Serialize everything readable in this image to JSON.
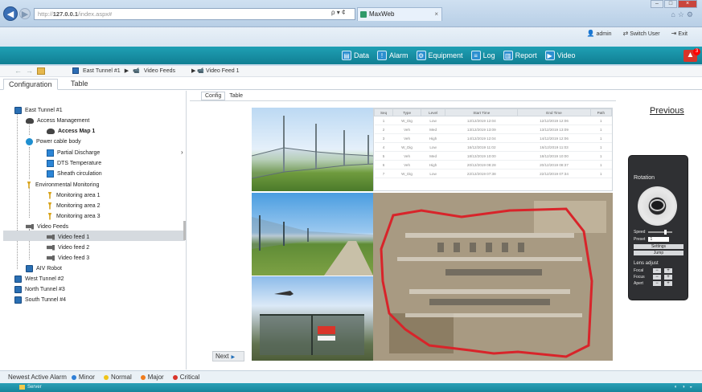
{
  "browser": {
    "url_scheme": "http://",
    "url_host": "127.0.0.1",
    "url_path": "/index.aspx#",
    "address_tools": "ρ ▾ ¢",
    "tab_title": "MaxWeb",
    "tab_close": "×"
  },
  "header": {
    "user": "admin",
    "switch_user": "Switch User",
    "exit": "Exit",
    "alarm_count": "3",
    "menu": [
      {
        "label": "Data",
        "icon": "data-icon",
        "color": "#2b8fd0"
      },
      {
        "label": "Alarm",
        "icon": "alarm-icon",
        "color": "#2b8fd0"
      },
      {
        "label": "Equipment",
        "icon": "equipment-icon",
        "color": "#2b8fd0"
      },
      {
        "label": "Log",
        "icon": "log-icon",
        "color": "#2b8fd0"
      },
      {
        "label": "Report",
        "icon": "report-icon",
        "color": "#2b8fd0"
      },
      {
        "label": "Video",
        "icon": "video-icon",
        "color": "#2b8fd0"
      }
    ]
  },
  "breadcrumb": {
    "item1": "East Tunnel #1",
    "item2": "Video Feeds",
    "item3": "Video Feed 1"
  },
  "tabs": {
    "configuration": "Configuration",
    "table": "Table"
  },
  "tree": {
    "east_tunnel": "East Tunnel #1",
    "access_management": "Access Management",
    "access_map": "Access Map 1",
    "power_cable": "Power cable body",
    "partial_discharge": "Partial Discharge",
    "dts_temperature": "DTS Temperature",
    "sheath_circulation": "Sheath circulation",
    "environmental_monitoring": "Environmental Monitoring",
    "area1": "Monitoring area 1",
    "area2": "Monitoring area 2",
    "area3": "Monitoring area 3",
    "video_feeds": "Video Feeds",
    "feed1": "Video feed 1",
    "feed2": "Video feed 2",
    "feed3": "Video feed 3",
    "aiv_robot": "AIV Robot",
    "west_tunnel": "West Tunnel #2",
    "north_tunnel": "North Tunnel #3",
    "south_tunnel": "South Tunnel #4"
  },
  "subtabs": {
    "config": "Config",
    "table": "Table"
  },
  "grid": {
    "headers": [
      "Seq",
      "Type",
      "Level",
      "Start Time",
      "End Time",
      "Path"
    ],
    "rows": [
      [
        "1",
        "W_Dig",
        "Low",
        "12/12/2019 12:04",
        "12/12/2019 12:06",
        "1"
      ],
      [
        "2",
        "Veh",
        "Med",
        "13/12/2019 13:09",
        "13/12/2019 13:09",
        "1"
      ],
      [
        "3",
        "Veh",
        "High",
        "14/12/2019 12:04",
        "14/12/2019 12:06",
        "1"
      ],
      [
        "4",
        "W_Dig",
        "Low",
        "16/12/2019 11:02",
        "16/12/2019 11:03",
        "1"
      ],
      [
        "5",
        "Veh",
        "Med",
        "18/12/2019 10:00",
        "18/12/2019 10:00",
        "1"
      ],
      [
        "6",
        "Veh",
        "High",
        "20/12/2019 08:28",
        "20/12/2019 08:37",
        "1"
      ],
      [
        "7",
        "W_Dig",
        "Low",
        "22/12/2019 07:38",
        "22/12/2019 07:34",
        "1"
      ]
    ]
  },
  "next_label": "Next",
  "previous_label": "Previous",
  "ptz": {
    "title": "Rotation",
    "speed": "Speed",
    "preset": "Preset",
    "preset_value": "1",
    "settings": "Settings",
    "jump": "Jump",
    "lens_adjust": "Lens adjust",
    "focal": "Focal",
    "focus": "Focus",
    "aperture": "Apert",
    "minus": "−",
    "plus": "+"
  },
  "alarm_bar": {
    "title": "Newest Active Alarm",
    "legend": [
      {
        "label": "Minor",
        "color": "#2f7fd6"
      },
      {
        "label": "Normal",
        "color": "#f0c419"
      },
      {
        "label": "Major",
        "color": "#f07c1c"
      },
      {
        "label": "Critical",
        "color": "#d9342a"
      }
    ]
  },
  "taskbar": {
    "start_label": "Server"
  }
}
